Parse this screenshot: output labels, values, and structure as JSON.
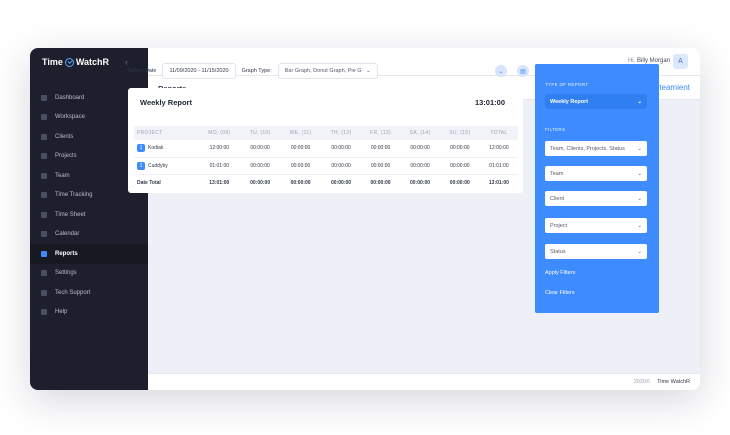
{
  "app": {
    "logo": "Time WatchR",
    "collapse_icon": "chevron-left-icon"
  },
  "sidebar": {
    "items": [
      {
        "label": "Dashboard",
        "icon": "dashboard-icon"
      },
      {
        "label": "Workspace",
        "icon": "workspace-icon"
      },
      {
        "label": "Clients",
        "icon": "clients-icon"
      },
      {
        "label": "Projects",
        "icon": "projects-icon"
      },
      {
        "label": "Team",
        "icon": "team-icon"
      },
      {
        "label": "Time Tracking",
        "icon": "time-tracking-icon"
      },
      {
        "label": "Time Sheet",
        "icon": "time-sheet-icon"
      },
      {
        "label": "Calendar",
        "icon": "calendar-icon"
      },
      {
        "label": "Reports",
        "icon": "reports-icon",
        "active": true
      },
      {
        "label": "Settings",
        "icon": "settings-icon"
      },
      {
        "label": "Tech Support",
        "icon": "tech-support-icon"
      },
      {
        "label": "Help",
        "icon": "help-icon"
      }
    ]
  },
  "header": {
    "greeting": "Hi,",
    "user_name": "Billy Morgan",
    "avatar_initial": "A"
  },
  "page": {
    "title": "Reports",
    "brand": "teamient"
  },
  "filters": {
    "select_date_label": "Select Date",
    "date_range": "11/09/2020 - 11/15/2020",
    "graph_type_label": "Graph Type:",
    "graph_type_value": "Bar Graph, Donut Graph, Pie G"
  },
  "report": {
    "title": "Weekly Report",
    "total": "13:01:00",
    "columns": [
      "PROJECT",
      "MO, (09)",
      "TU, (10)",
      "WE, (11)",
      "TH, (12)",
      "FR, (13)",
      "SA, (14)",
      "SU, (15)",
      "TOTAL"
    ],
    "rows": [
      {
        "badge": "1",
        "project": "Kodiak",
        "values": [
          "12:00:00",
          "00:00:00",
          "00:00:00",
          "00:00:00",
          "00:00:00",
          "00:00:00",
          "00:00:00",
          "12:00:00"
        ]
      },
      {
        "badge": "1",
        "project": "Cuddyby",
        "values": [
          "01:01:00",
          "00:00:00",
          "00:00:00",
          "00:00:00",
          "00:00:00",
          "00:00:00",
          "00:00:00",
          "01:01:00"
        ]
      }
    ],
    "date_total": {
      "label": "Date Total",
      "values": [
        "13:01:00",
        "00:00:00",
        "00:00:00",
        "00:00:00",
        "00:00:00",
        "00:00:00",
        "00:00:00",
        "13:01:00"
      ]
    }
  },
  "panel": {
    "type_label": "TYPE OF REPORT",
    "type_value": "Weekly Report",
    "filters_label": "FILTERS",
    "selects": [
      "Team, Clients, Projects, Status",
      "Team",
      "Client",
      "Project",
      "Status"
    ],
    "apply": "Apply Filters",
    "clear": "Clear Filters"
  },
  "footer": {
    "year": "2020©",
    "name": "Time WatchR"
  }
}
